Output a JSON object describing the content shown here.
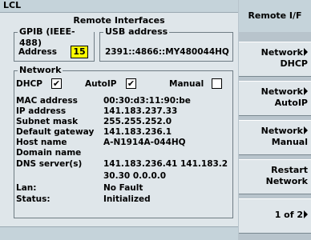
{
  "window": {
    "title": "LCL"
  },
  "panel_title": "Remote Interfaces",
  "gpib": {
    "label": "GPIB (IEEE-488)",
    "address_label": "Address",
    "address_value": "15"
  },
  "usb": {
    "label": "USB address",
    "value": "2391::4866::MY480044HQ"
  },
  "network": {
    "label": "Network",
    "dhcp_label": "DHCP",
    "dhcp_checked": "✔",
    "autoip_label": "AutoIP",
    "autoip_checked": "✔",
    "manual_label": "Manual"
  },
  "info": [
    {
      "label": "MAC address",
      "value": "00:30:d3:11:90:be"
    },
    {
      "label": "IP address",
      "value": "141.183.237.33"
    },
    {
      "label": "Subnet mask",
      "value": "255.255.252.0"
    },
    {
      "label": "Default gateway",
      "value": "141.183.236.1"
    },
    {
      "label": "Host name",
      "value": "A-N1914A-044HQ"
    },
    {
      "label": "Domain name",
      "value": ""
    },
    {
      "label": "DNS server(s)",
      "value": "141.183.236.41  141.183.2"
    },
    {
      "label": "",
      "value": "30.30  0.0.0.0"
    },
    {
      "label": "Lan:",
      "value": "No Fault"
    },
    {
      "label": "Status:",
      "value": "Initialized"
    }
  ],
  "softkeys": {
    "header": "Remote I/F",
    "keys": [
      {
        "line1": "Network",
        "line2": "DHCP"
      },
      {
        "line1": "Network",
        "line2": "AutoIP"
      },
      {
        "line1": "Network",
        "line2": "Manual"
      },
      {
        "line1": "Restart",
        "line2": "Network"
      }
    ],
    "page": "1 of 2"
  }
}
